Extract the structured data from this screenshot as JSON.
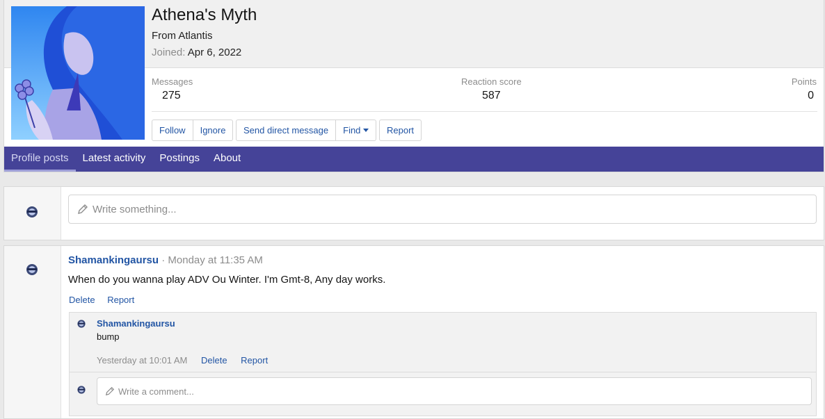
{
  "profile": {
    "username": "Athena's Myth",
    "location": "From Atlantis",
    "joined_label": "Joined:",
    "joined_value": "Apr 6, 2022",
    "stats": [
      {
        "label": "Messages",
        "value": "275"
      },
      {
        "label": "Reaction score",
        "value": "587"
      },
      {
        "label": "Points",
        "value": "0"
      }
    ],
    "buttons": {
      "follow": "Follow",
      "ignore": "Ignore",
      "send_dm": "Send direct message",
      "find": "Find",
      "report": "Report"
    }
  },
  "tabs": [
    {
      "label": "Profile posts",
      "active": true
    },
    {
      "label": "Latest activity"
    },
    {
      "label": "Postings"
    },
    {
      "label": "About"
    }
  ],
  "composer": {
    "placeholder": "Write something..."
  },
  "post": {
    "author": "Shamankingaursu",
    "separator": "·",
    "time": "Monday at 11:35 AM",
    "message": "When do you wanna play ADV Ou Winter. I'm Gmt-8, Any day works.",
    "actions": {
      "delete": "Delete",
      "report": "Report"
    },
    "comment": {
      "author": "Shamankingaursu",
      "text": "bump",
      "time": "Yesterday at 10:01 AM",
      "delete": "Delete",
      "report": "Report"
    },
    "comment_placeholder": "Write a comment..."
  },
  "colors": {
    "nav_bar": "#454398",
    "link": "#2255a4",
    "muted": "#8c8c8c"
  }
}
